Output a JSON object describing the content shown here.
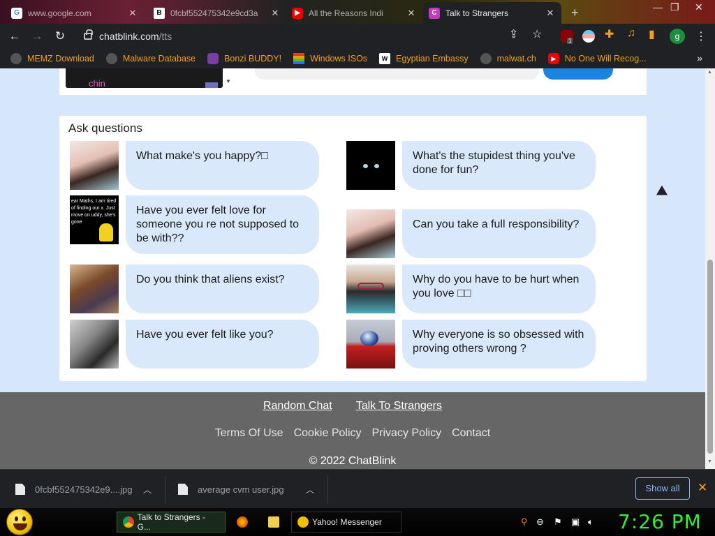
{
  "browser": {
    "tabs": [
      {
        "title": "www.google.com",
        "favicon": "google-icon"
      },
      {
        "title": "0fcbf552475342e9cd3a",
        "favicon": "bing-icon"
      },
      {
        "title": "All the Reasons Indi",
        "favicon": "youtube-icon"
      },
      {
        "title": "Talk to Strangers",
        "favicon": "chatblink-icon",
        "active": true
      }
    ],
    "new_tab_symbol": "+",
    "url_host": "chatblink.com",
    "url_path": "/tts",
    "extension_badge": "1",
    "profile_letter": "g"
  },
  "bookmarks": [
    {
      "label": "MEMZ Download",
      "icon": "globe-icon"
    },
    {
      "label": "Malware Database",
      "icon": "globe-icon"
    },
    {
      "label": "Bonzi BUDDY!",
      "icon": "bonzi-icon"
    },
    {
      "label": "Windows ISOs",
      "icon": "windows-icon"
    },
    {
      "label": "Egyptian Embassy",
      "icon": "wix-icon"
    },
    {
      "label": "malwat.ch",
      "icon": "globe-icon"
    },
    {
      "label": "No One Will Recog...",
      "icon": "youtube-icon"
    }
  ],
  "top_card": {
    "user_name": "chin"
  },
  "questions_section": {
    "heading": "Ask questions",
    "left": [
      {
        "text": "What make's you happy?□",
        "pic": "girl-selfie"
      },
      {
        "text": "Have you ever felt love for someone you re not supposed to be with??",
        "pic": "maths-meme"
      },
      {
        "text": "Do you think that aliens exist?",
        "pic": "mirror-selfie"
      },
      {
        "text": "Have you ever felt like you?",
        "pic": "boy-portrait"
      }
    ],
    "right": [
      {
        "text": "What's the stupidest thing you've done for fun?",
        "pic": "black-cat"
      },
      {
        "text": "Can you take a full responsibility?",
        "pic": "girl-selfie"
      },
      {
        "text": "Why do you have to be hurt when you love □□",
        "pic": "girl-glasses"
      },
      {
        "text": "Why everyone is so obsessed with proving others wrong ?",
        "pic": "water-drop"
      }
    ],
    "maths_meme_text": "ear Maths, I am tired of finding our x. Just move on uddy, she's gone"
  },
  "footer": {
    "primary_links": [
      "Random Chat",
      "Talk To Strangers"
    ],
    "secondary_links": [
      "Terms Of Use",
      "Cookie Policy",
      "Privacy Policy",
      "Contact"
    ],
    "copyright": "© 2022 ChatBlink"
  },
  "downloads": [
    {
      "name": "0fcbf552475342e9....jpg"
    },
    {
      "name": "average cvm user.jpg"
    }
  ],
  "downloads_show_all": "Show all",
  "taskbar": {
    "items": [
      {
        "label": "Talk to Strangers - G...",
        "icon": "chrome-icon",
        "active": true
      },
      {
        "label": "Yahoo! Messenger",
        "icon": "yahoo-messenger-icon"
      }
    ],
    "clock": "7:26 PM"
  },
  "colors": {
    "page_bg": "#d6e6fb",
    "bubble": "#d9e8fb",
    "footer": "#666666",
    "accent_blue": "#1a84e0",
    "bookmark_text": "#f0a020",
    "clock": "#30f030"
  }
}
